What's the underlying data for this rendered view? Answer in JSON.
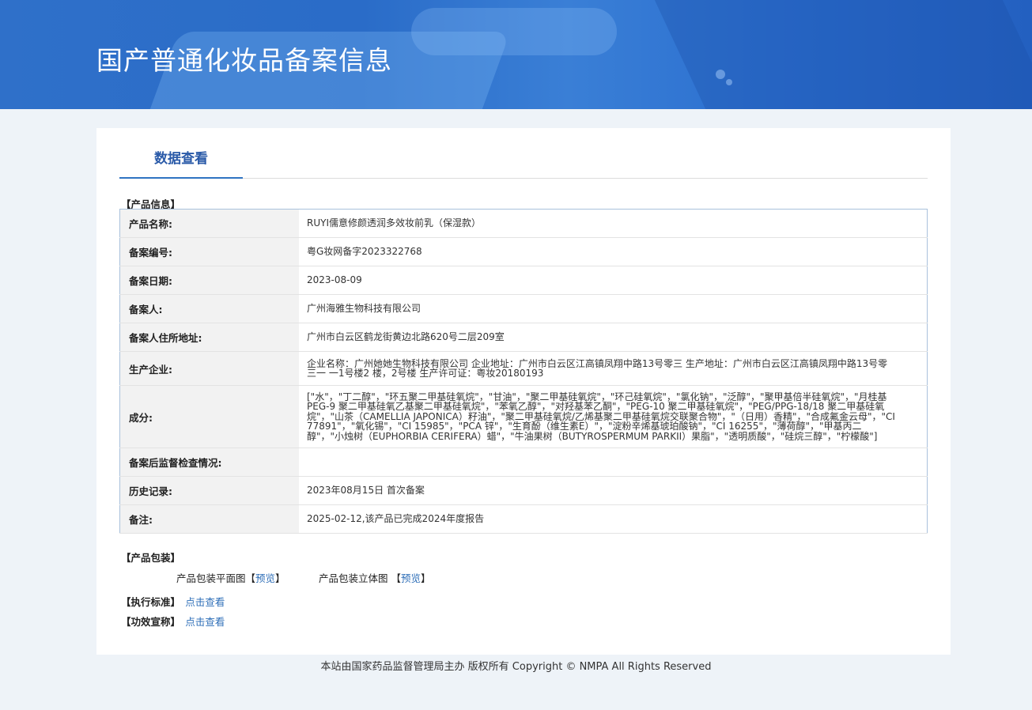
{
  "header": {
    "title": "国产普通化妆品备案信息"
  },
  "tabs": [
    {
      "label": "数据查看",
      "active": true
    }
  ],
  "product_info": {
    "section_label": "【产品信息】",
    "rows": [
      {
        "key": "产品名称:",
        "value": "RUYI儒意修颜透润多效妆前乳（保湿款）"
      },
      {
        "key": "备案编号:",
        "value": "粤G妆网备字2023322768"
      },
      {
        "key": "备案日期:",
        "value": "2023-08-09"
      },
      {
        "key": "备案人:",
        "value": "广州海雅生物科技有限公司"
      },
      {
        "key": "备案人住所地址:",
        "value": "广州市白云区鹤龙街黄边北路620号二层209室"
      },
      {
        "key": "生产企业:",
        "value": "企业名称：广州她她生物科技有限公司 企业地址：广州市白云区江高镇凤翔中路13号零三 生产地址：广州市白云区江高镇凤翔中路13号零三一 一1号楼2 楼，2号楼 生产许可证：粤妆20180193"
      },
      {
        "key": "成分:",
        "value": "[\"水\"，\"丁二醇\"，\"环五聚二甲基硅氧烷\"，\"甘油\"，\"聚二甲基硅氧烷\"，\"环己硅氧烷\"，\"氯化钠\"，\"泛醇\"，\"聚甲基倍半硅氧烷\"，\"月桂基PEG-9 聚二甲基硅氧乙基聚二甲基硅氧烷\"，\"苯氧乙醇\"，\"对羟基苯乙酮\"，\"PEG-10 聚二甲基硅氧烷\"，\"PEG/PPG-18/18 聚二甲基硅氧烷\"，\"山茶（CAMELLIA JAPONICA）籽油\"，\"聚二甲基硅氧烷/乙烯基聚二甲基硅氧烷交联聚合物\"，\"（日用）香精\"，\"合成氟金云母\"，\"CI 77891\"，\"氧化锡\"，\"CI 15985\"，\"PCA 锌\"，\"生育酚（维生素E）\"，\"淀粉辛烯基琥珀酸钠\"，\"CI 16255\"，\"薄荷醇\"，\"甲基丙二醇\"，\"小烛树（EUPHORBIA CERIFERA）蜡\"，\"牛油果树（BUTYROSPERMUM PARKII）果脂\"，\"透明质酸\"，\"硅烷三醇\"，\"柠檬酸\"]"
      },
      {
        "key": "备案后监督检查情况:",
        "value": ""
      },
      {
        "key": "历史记录:",
        "value": "2023年08月15日 首次备案"
      },
      {
        "key": "备注:",
        "value": "2025-02-12,该产品已完成2024年度报告"
      }
    ]
  },
  "packaging": {
    "section_label": "【产品包装】",
    "flat_label": "产品包装平面图",
    "flat_bracket_open": "【",
    "flat_link": "预览",
    "flat_bracket_close": "】",
    "solid_label": "产品包装立体图",
    "solid_bracket_open": "【",
    "solid_link": "预览",
    "solid_bracket_close": "】"
  },
  "standard": {
    "label": "【执行标准】",
    "link": "点击查看"
  },
  "efficacy": {
    "label": "【功效宣称】",
    "link": "点击查看"
  },
  "footer": {
    "text": "本站由国家药品监督管理局主办 版权所有 Copyright © NMPA All Rights Reserved"
  }
}
